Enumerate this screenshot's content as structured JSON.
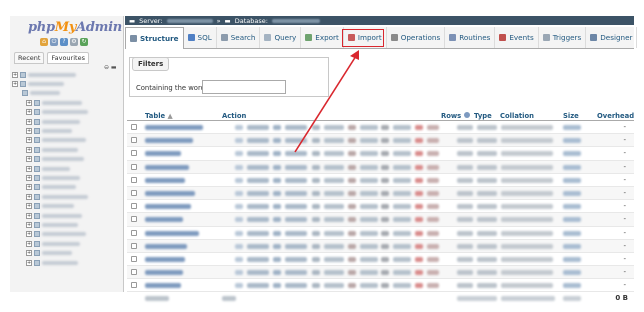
{
  "app": {
    "logo_php": "php",
    "logo_my": "My",
    "logo_admin": "Admin"
  },
  "nav": {
    "tabs": [
      "Recent",
      "Favourites"
    ],
    "tree_rows": 21
  },
  "breadcrumb": {
    "server_label": "Server:",
    "database_label": "Database:"
  },
  "menu": {
    "tabs": [
      {
        "label": "Structure",
        "icon": "structure-icon",
        "active": true
      },
      {
        "label": "SQL",
        "icon": "sql-icon"
      },
      {
        "label": "Search",
        "icon": "search-icon"
      },
      {
        "label": "Query",
        "icon": "query-icon"
      },
      {
        "label": "Export",
        "icon": "export-icon"
      },
      {
        "label": "Import",
        "icon": "import-icon",
        "highlighted": true
      },
      {
        "label": "Operations",
        "icon": "wrench-icon"
      },
      {
        "label": "Routines",
        "icon": "routines-icon"
      },
      {
        "label": "Events",
        "icon": "events-icon"
      },
      {
        "label": "Triggers",
        "icon": "triggers-icon"
      },
      {
        "label": "Designer",
        "icon": "designer-icon"
      }
    ]
  },
  "filters": {
    "legend": "Filters",
    "label": "Containing the word:",
    "value": ""
  },
  "table": {
    "headers": {
      "table": "Table",
      "action": "Action",
      "rows": "Rows",
      "type": "Type",
      "collation": "Collation",
      "size": "Size",
      "overhead": "Overhead"
    },
    "row_count": 13,
    "overhead_cell": "-",
    "footer_end": "0 B"
  },
  "colors": {
    "annotation": "#d9272e",
    "breadcrumb_bg": "#3c5366",
    "link": "#235a81"
  }
}
